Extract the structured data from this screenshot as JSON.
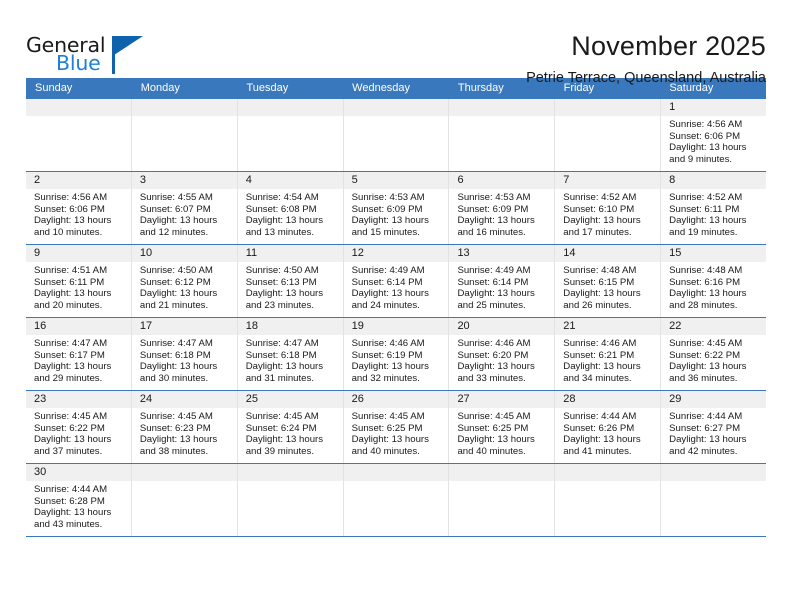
{
  "brand": {
    "name_part1": "General",
    "name_part2": "Blue",
    "accent_color": "#1f7fd4",
    "flag_color": "#0f62ac",
    "logo_icon": "flag-triangle-icon"
  },
  "header": {
    "title": "November 2025",
    "subtitle": "Petrie Terrace, Queensland, Australia"
  },
  "theme": {
    "header_row_bg": "#3a78bd",
    "daynum_bg": "#f0f0f0",
    "grid_line": "#e3e3e3",
    "week_divider": "#3a78bd"
  },
  "weekdays": [
    "Sunday",
    "Monday",
    "Tuesday",
    "Wednesday",
    "Thursday",
    "Friday",
    "Saturday"
  ],
  "labels": {
    "sunrise": "Sunrise:",
    "sunset": "Sunset:",
    "daylight": "Daylight:"
  },
  "weeks": [
    [
      {
        "day": "",
        "sunrise": "",
        "sunset": "",
        "daylight_line1": "",
        "daylight_line2": ""
      },
      {
        "day": "",
        "sunrise": "",
        "sunset": "",
        "daylight_line1": "",
        "daylight_line2": ""
      },
      {
        "day": "",
        "sunrise": "",
        "sunset": "",
        "daylight_line1": "",
        "daylight_line2": ""
      },
      {
        "day": "",
        "sunrise": "",
        "sunset": "",
        "daylight_line1": "",
        "daylight_line2": ""
      },
      {
        "day": "",
        "sunrise": "",
        "sunset": "",
        "daylight_line1": "",
        "daylight_line2": ""
      },
      {
        "day": "",
        "sunrise": "",
        "sunset": "",
        "daylight_line1": "",
        "daylight_line2": ""
      },
      {
        "day": "1",
        "sunrise": "Sunrise: 4:56 AM",
        "sunset": "Sunset: 6:06 PM",
        "daylight_line1": "Daylight: 13 hours",
        "daylight_line2": "and 9 minutes."
      }
    ],
    [
      {
        "day": "2",
        "sunrise": "Sunrise: 4:56 AM",
        "sunset": "Sunset: 6:06 PM",
        "daylight_line1": "Daylight: 13 hours",
        "daylight_line2": "and 10 minutes."
      },
      {
        "day": "3",
        "sunrise": "Sunrise: 4:55 AM",
        "sunset": "Sunset: 6:07 PM",
        "daylight_line1": "Daylight: 13 hours",
        "daylight_line2": "and 12 minutes."
      },
      {
        "day": "4",
        "sunrise": "Sunrise: 4:54 AM",
        "sunset": "Sunset: 6:08 PM",
        "daylight_line1": "Daylight: 13 hours",
        "daylight_line2": "and 13 minutes."
      },
      {
        "day": "5",
        "sunrise": "Sunrise: 4:53 AM",
        "sunset": "Sunset: 6:09 PM",
        "daylight_line1": "Daylight: 13 hours",
        "daylight_line2": "and 15 minutes."
      },
      {
        "day": "6",
        "sunrise": "Sunrise: 4:53 AM",
        "sunset": "Sunset: 6:09 PM",
        "daylight_line1": "Daylight: 13 hours",
        "daylight_line2": "and 16 minutes."
      },
      {
        "day": "7",
        "sunrise": "Sunrise: 4:52 AM",
        "sunset": "Sunset: 6:10 PM",
        "daylight_line1": "Daylight: 13 hours",
        "daylight_line2": "and 17 minutes."
      },
      {
        "day": "8",
        "sunrise": "Sunrise: 4:52 AM",
        "sunset": "Sunset: 6:11 PM",
        "daylight_line1": "Daylight: 13 hours",
        "daylight_line2": "and 19 minutes."
      }
    ],
    [
      {
        "day": "9",
        "sunrise": "Sunrise: 4:51 AM",
        "sunset": "Sunset: 6:11 PM",
        "daylight_line1": "Daylight: 13 hours",
        "daylight_line2": "and 20 minutes."
      },
      {
        "day": "10",
        "sunrise": "Sunrise: 4:50 AM",
        "sunset": "Sunset: 6:12 PM",
        "daylight_line1": "Daylight: 13 hours",
        "daylight_line2": "and 21 minutes."
      },
      {
        "day": "11",
        "sunrise": "Sunrise: 4:50 AM",
        "sunset": "Sunset: 6:13 PM",
        "daylight_line1": "Daylight: 13 hours",
        "daylight_line2": "and 23 minutes."
      },
      {
        "day": "12",
        "sunrise": "Sunrise: 4:49 AM",
        "sunset": "Sunset: 6:14 PM",
        "daylight_line1": "Daylight: 13 hours",
        "daylight_line2": "and 24 minutes."
      },
      {
        "day": "13",
        "sunrise": "Sunrise: 4:49 AM",
        "sunset": "Sunset: 6:14 PM",
        "daylight_line1": "Daylight: 13 hours",
        "daylight_line2": "and 25 minutes."
      },
      {
        "day": "14",
        "sunrise": "Sunrise: 4:48 AM",
        "sunset": "Sunset: 6:15 PM",
        "daylight_line1": "Daylight: 13 hours",
        "daylight_line2": "and 26 minutes."
      },
      {
        "day": "15",
        "sunrise": "Sunrise: 4:48 AM",
        "sunset": "Sunset: 6:16 PM",
        "daylight_line1": "Daylight: 13 hours",
        "daylight_line2": "and 28 minutes."
      }
    ],
    [
      {
        "day": "16",
        "sunrise": "Sunrise: 4:47 AM",
        "sunset": "Sunset: 6:17 PM",
        "daylight_line1": "Daylight: 13 hours",
        "daylight_line2": "and 29 minutes."
      },
      {
        "day": "17",
        "sunrise": "Sunrise: 4:47 AM",
        "sunset": "Sunset: 6:18 PM",
        "daylight_line1": "Daylight: 13 hours",
        "daylight_line2": "and 30 minutes."
      },
      {
        "day": "18",
        "sunrise": "Sunrise: 4:47 AM",
        "sunset": "Sunset: 6:18 PM",
        "daylight_line1": "Daylight: 13 hours",
        "daylight_line2": "and 31 minutes."
      },
      {
        "day": "19",
        "sunrise": "Sunrise: 4:46 AM",
        "sunset": "Sunset: 6:19 PM",
        "daylight_line1": "Daylight: 13 hours",
        "daylight_line2": "and 32 minutes."
      },
      {
        "day": "20",
        "sunrise": "Sunrise: 4:46 AM",
        "sunset": "Sunset: 6:20 PM",
        "daylight_line1": "Daylight: 13 hours",
        "daylight_line2": "and 33 minutes."
      },
      {
        "day": "21",
        "sunrise": "Sunrise: 4:46 AM",
        "sunset": "Sunset: 6:21 PM",
        "daylight_line1": "Daylight: 13 hours",
        "daylight_line2": "and 34 minutes."
      },
      {
        "day": "22",
        "sunrise": "Sunrise: 4:45 AM",
        "sunset": "Sunset: 6:22 PM",
        "daylight_line1": "Daylight: 13 hours",
        "daylight_line2": "and 36 minutes."
      }
    ],
    [
      {
        "day": "23",
        "sunrise": "Sunrise: 4:45 AM",
        "sunset": "Sunset: 6:22 PM",
        "daylight_line1": "Daylight: 13 hours",
        "daylight_line2": "and 37 minutes."
      },
      {
        "day": "24",
        "sunrise": "Sunrise: 4:45 AM",
        "sunset": "Sunset: 6:23 PM",
        "daylight_line1": "Daylight: 13 hours",
        "daylight_line2": "and 38 minutes."
      },
      {
        "day": "25",
        "sunrise": "Sunrise: 4:45 AM",
        "sunset": "Sunset: 6:24 PM",
        "daylight_line1": "Daylight: 13 hours",
        "daylight_line2": "and 39 minutes."
      },
      {
        "day": "26",
        "sunrise": "Sunrise: 4:45 AM",
        "sunset": "Sunset: 6:25 PM",
        "daylight_line1": "Daylight: 13 hours",
        "daylight_line2": "and 40 minutes."
      },
      {
        "day": "27",
        "sunrise": "Sunrise: 4:45 AM",
        "sunset": "Sunset: 6:25 PM",
        "daylight_line1": "Daylight: 13 hours",
        "daylight_line2": "and 40 minutes."
      },
      {
        "day": "28",
        "sunrise": "Sunrise: 4:44 AM",
        "sunset": "Sunset: 6:26 PM",
        "daylight_line1": "Daylight: 13 hours",
        "daylight_line2": "and 41 minutes."
      },
      {
        "day": "29",
        "sunrise": "Sunrise: 4:44 AM",
        "sunset": "Sunset: 6:27 PM",
        "daylight_line1": "Daylight: 13 hours",
        "daylight_line2": "and 42 minutes."
      }
    ],
    [
      {
        "day": "30",
        "sunrise": "Sunrise: 4:44 AM",
        "sunset": "Sunset: 6:28 PM",
        "daylight_line1": "Daylight: 13 hours",
        "daylight_line2": "and 43 minutes."
      },
      {
        "day": "",
        "sunrise": "",
        "sunset": "",
        "daylight_line1": "",
        "daylight_line2": ""
      },
      {
        "day": "",
        "sunrise": "",
        "sunset": "",
        "daylight_line1": "",
        "daylight_line2": ""
      },
      {
        "day": "",
        "sunrise": "",
        "sunset": "",
        "daylight_line1": "",
        "daylight_line2": ""
      },
      {
        "day": "",
        "sunrise": "",
        "sunset": "",
        "daylight_line1": "",
        "daylight_line2": ""
      },
      {
        "day": "",
        "sunrise": "",
        "sunset": "",
        "daylight_line1": "",
        "daylight_line2": ""
      },
      {
        "day": "",
        "sunrise": "",
        "sunset": "",
        "daylight_line1": "",
        "daylight_line2": ""
      }
    ]
  ]
}
